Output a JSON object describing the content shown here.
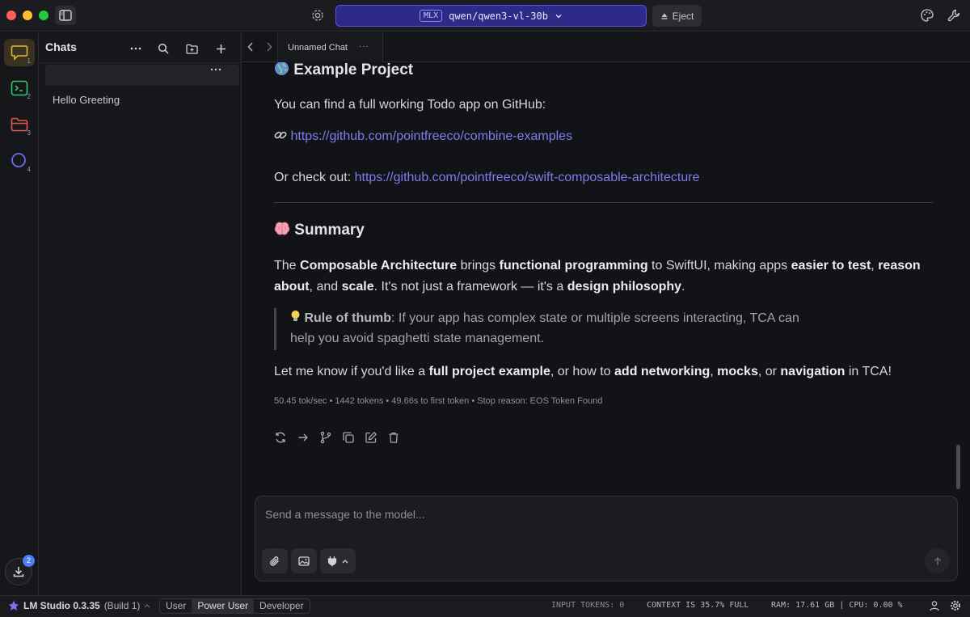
{
  "titlebar": {
    "model_badge": "MLX",
    "model_name": "qwen/qwen3-vl-30b",
    "eject_label": "Eject"
  },
  "rail": {
    "items": [
      {
        "icon": "chat-icon",
        "num": "1",
        "color": "#e3b341"
      },
      {
        "icon": "terminal-icon",
        "num": "2",
        "color": "#3fbf6a"
      },
      {
        "icon": "folder-icon",
        "num": "3",
        "color": "#e05a4a"
      },
      {
        "icon": "search-circle-icon",
        "num": "4",
        "color": "#6f6ae8"
      }
    ],
    "download_badge": "2"
  },
  "chats": {
    "title": "Chats",
    "items": [
      "Hello Greeting"
    ]
  },
  "tabs": {
    "active": "Unnamed Chat",
    "menu": "···"
  },
  "message": {
    "example_heading": "Example Project",
    "example_text": "You can find a full working Todo app on GitHub:",
    "link1": "https://github.com/pointfreeco/combine-examples",
    "checkout_prefix": "Or check out: ",
    "link2": "https://github.com/pointfreeco/swift-composable-architecture",
    "summary_heading": "Summary",
    "summary": {
      "t1": "The ",
      "b1": "Composable Architecture",
      "t2": " brings ",
      "b2": "functional programming",
      "t3": " to SwiftUI, making apps ",
      "b3": "easier to test",
      "t4": ", ",
      "b4": "reason",
      "b5": "about",
      "t5": ", and ",
      "b6": "scale",
      "t6": ". It's not just a framework — it's a ",
      "b7": "design philosophy",
      "t7": "."
    },
    "quote": {
      "b": "Rule of thumb",
      "t1": ": If your app has complex state or multiple screens interacting, TCA can",
      "t2": "help you avoid spaghetti state management."
    },
    "closing": {
      "t1": "Let me know if you'd like a ",
      "b1": "full project example",
      "t2": ", or how to ",
      "b2": "add networking",
      "t3": ", ",
      "b3": "mocks",
      "t4": ", or ",
      "b4": "navigation",
      "t5": " in TCA!"
    },
    "stats": "50.45 tok/sec  •  1442 tokens  •  49.66s to first token  •  Stop reason: EOS Token Found"
  },
  "composer": {
    "placeholder": "Send a message to the model..."
  },
  "statusbar": {
    "app": "LM Studio 0.3.35",
    "build": "(Build 1)",
    "modes": [
      "User",
      "Power User",
      "Developer"
    ],
    "active_mode": "Power User",
    "input_tokens": "INPUT TOKENS: 0",
    "context": "CONTEXT IS 35.7% FULL",
    "ram_cpu": "RAM: 17.61 GB  |  CPU: 0.00 %"
  },
  "colors": {
    "accent": "#5b50e0",
    "link": "#7e7cf0"
  }
}
